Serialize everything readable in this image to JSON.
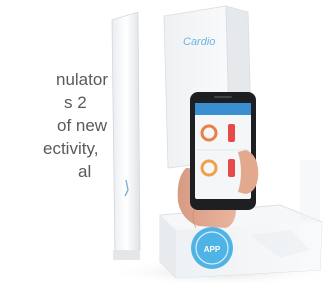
{
  "intro_text": {
    "lines": [
      "nulator",
      "s 2",
      "of new",
      "ectivity,",
      "al"
    ]
  },
  "product": {
    "box_logo_text": "Cardio",
    "sticker_text": "APP"
  },
  "phone_screen": {
    "color": "#3a8fd1",
    "gauge_colors": [
      "#e8804a",
      "#e84a4a",
      "#f0a04a",
      "#e84a4a"
    ]
  }
}
